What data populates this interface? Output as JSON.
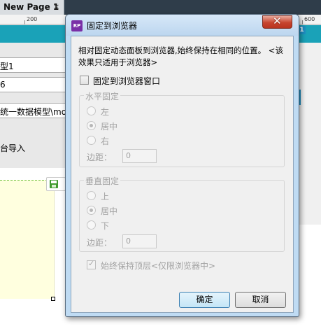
{
  "editor": {
    "tab_label": "New Page 1",
    "tab_close": "×",
    "ruler_left": "200",
    "ruler_right": "600",
    "page_badge": "1",
    "field_1": "型1",
    "field_2": "6",
    "field_3": "统一数据模型\\mo",
    "static_text": "台导入"
  },
  "dialog": {
    "app_icon": "RP",
    "title": "固定到浏览器",
    "close_glyph": "✕",
    "description": "相对固定动态面板到浏览器,始终保持在相同的位置。 <该效果只适用于浏览器>",
    "pin_checkbox_label": "固定到浏览器窗口",
    "pin_checked": false,
    "horizontal": {
      "title": "水平固定",
      "options": [
        "左",
        "居中",
        "右"
      ],
      "selected": "居中",
      "margin_label": "边距：",
      "margin_value": "0"
    },
    "vertical": {
      "title": "垂直固定",
      "options": [
        "上",
        "居中",
        "下"
      ],
      "selected": "居中",
      "margin_label": "边距：",
      "margin_value": "0"
    },
    "always_on_top_label": "始终保持顶层<仅限浏览器中>",
    "always_on_top_checked": true,
    "ok_label": "确定",
    "cancel_label": "取消"
  },
  "colors": {
    "teal_panel": "#1aa2b8",
    "dialog_frame": "#bfdbf3",
    "close_button": "#c7452f",
    "icon_purple": "#7a2fa7"
  }
}
